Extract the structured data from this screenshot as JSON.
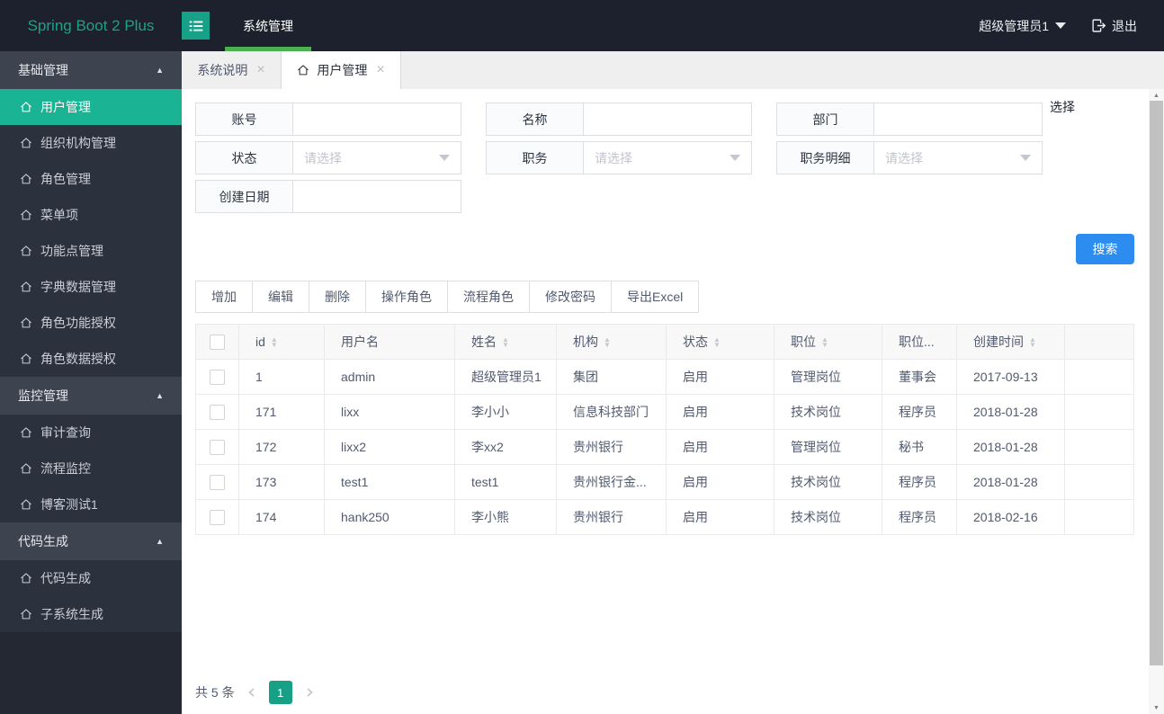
{
  "header": {
    "logo": "Spring Boot 2 Plus",
    "nav": {
      "label": "系统管理",
      "active": true
    },
    "user": "超级管理员1",
    "logout_label": "退出"
  },
  "sidebar": {
    "item_icon": "home",
    "active_item": "用户管理",
    "sections": [
      {
        "label": "基础管理",
        "collapse_icon": "caret-up",
        "items": [
          "用户管理",
          "组织机构管理",
          "角色管理",
          "菜单项",
          "功能点管理",
          "字典数据管理",
          "角色功能授权",
          "角色数据授权"
        ]
      },
      {
        "label": "监控管理",
        "collapse_icon": "caret-up",
        "items": [
          "审计查询",
          "流程监控",
          "博客测试1"
        ]
      },
      {
        "label": "代码生成",
        "collapse_icon": "caret-up",
        "items": [
          "代码生成",
          "子系统生成"
        ]
      }
    ]
  },
  "tabs": [
    {
      "label": "系统说明",
      "active": false,
      "icon": null,
      "closable": true
    },
    {
      "label": "用户管理",
      "active": true,
      "icon": "home",
      "closable": true
    }
  ],
  "search_form": {
    "fields": [
      {
        "label": "账号",
        "type": "input",
        "value": ""
      },
      {
        "label": "名称",
        "type": "input",
        "value": ""
      },
      {
        "label": "部门",
        "type": "input",
        "value": ""
      },
      {
        "label": "状态",
        "type": "select",
        "placeholder": "请选择"
      },
      {
        "label": "职务",
        "type": "select",
        "placeholder": "请选择"
      },
      {
        "label": "职务明细",
        "type": "select",
        "placeholder": "请选择"
      },
      {
        "label": "创建日期",
        "type": "input",
        "value": ""
      }
    ],
    "choose_link": "选择",
    "search_button": "搜索"
  },
  "toolbar": [
    "增加",
    "编辑",
    "删除",
    "操作角色",
    "流程角色",
    "修改密码",
    "导出Excel"
  ],
  "table": {
    "columns": [
      {
        "label": "id",
        "sortable": true
      },
      {
        "label": "用户名",
        "sortable": false
      },
      {
        "label": "姓名",
        "sortable": true
      },
      {
        "label": "机构",
        "sortable": true
      },
      {
        "label": "状态",
        "sortable": true
      },
      {
        "label": "职位",
        "sortable": true
      },
      {
        "label": "职位...",
        "sortable": false
      },
      {
        "label": "创建时间",
        "sortable": true
      }
    ],
    "rows": [
      [
        "1",
        "admin",
        "超级管理员1",
        "集团",
        "启用",
        "管理岗位",
        "董事会",
        "2017-09-13"
      ],
      [
        "171",
        "lixx",
        "李小小",
        "信息科技部门",
        "启用",
        "技术岗位",
        "程序员",
        "2018-01-28"
      ],
      [
        "172",
        "lixx2",
        "李xx2",
        "贵州银行",
        "启用",
        "管理岗位",
        "秘书",
        "2018-01-28"
      ],
      [
        "173",
        "test1",
        "test1",
        "贵州银行金...",
        "启用",
        "技术岗位",
        "程序员",
        "2018-01-28"
      ],
      [
        "174",
        "hank250",
        "李小熊",
        "贵州银行",
        "启用",
        "技术岗位",
        "程序员",
        "2018-02-16"
      ]
    ]
  },
  "pagination": {
    "total": "共 5 条",
    "current_page": "1"
  },
  "colors": {
    "header_bg": "#1c212d",
    "sidebar_bg": "#232833",
    "sidebar_active_teal": "#1ab394",
    "nav_underline_green": "#4cb050",
    "brand_teal": "#18a189",
    "search_button_blue": "#2d8cf0",
    "pagination_active_teal": "#16a085"
  }
}
